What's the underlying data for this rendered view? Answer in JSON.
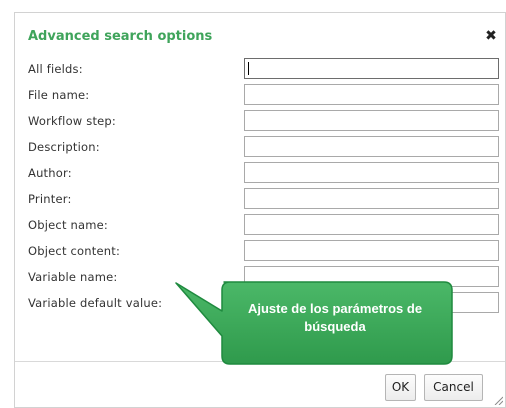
{
  "dialog": {
    "title": "Advanced search options",
    "close_glyph": "✖",
    "fields": [
      {
        "label": "All fields:",
        "value": ""
      },
      {
        "label": "File name:",
        "value": ""
      },
      {
        "label": "Workflow step:",
        "value": ""
      },
      {
        "label": "Description:",
        "value": ""
      },
      {
        "label": "Author:",
        "value": ""
      },
      {
        "label": "Printer:",
        "value": ""
      },
      {
        "label": "Object name:",
        "value": ""
      },
      {
        "label": "Object content:",
        "value": ""
      },
      {
        "label": "Variable name:",
        "value": ""
      },
      {
        "label": "Variable default value:",
        "value": ""
      }
    ],
    "ok_label": "OK",
    "cancel_label": "Cancel"
  },
  "callout": {
    "text": "Ajuste de los parámetros de búsqueda",
    "fill_color": "#3aa858",
    "border_color": "#1e8a3e"
  },
  "colors": {
    "title": "#3fa45b"
  }
}
